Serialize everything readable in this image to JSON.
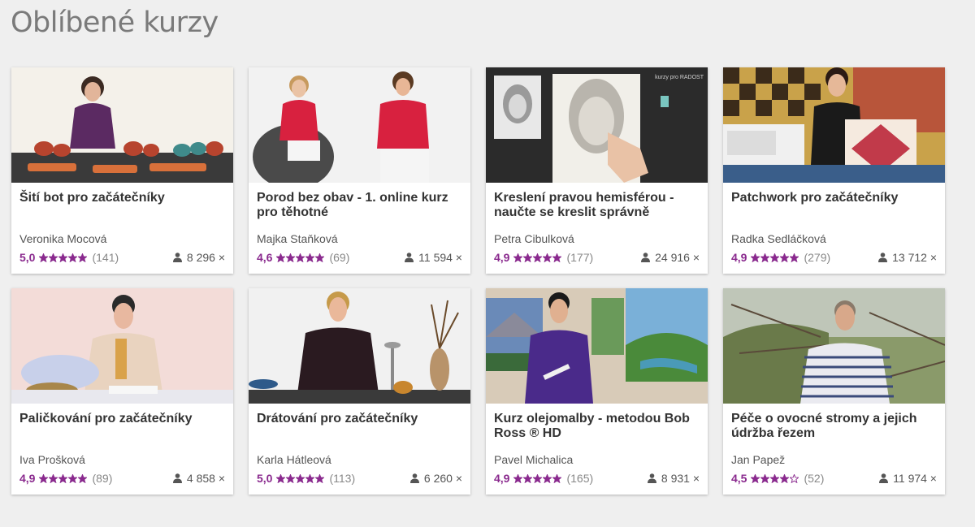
{
  "page": {
    "title": "Oblíbené kurzy"
  },
  "colors": {
    "accent": "#8a2a8e",
    "background": "#efefef",
    "card": "#ffffff"
  },
  "courses": [
    {
      "title": "Šití bot pro začátečníky",
      "author": "Veronika Mocová",
      "rating": "5,0",
      "stars": 5,
      "reviews": "(141)",
      "students": "8 296 ×",
      "thumb_icon": "shoes-workshop-image"
    },
    {
      "title": "Porod bez obav - 1. online kurz pro těhotné",
      "author": "Majka Staňková",
      "rating": "4,6",
      "stars": 5,
      "reviews": "(69)",
      "students": "11 594 ×",
      "thumb_icon": "pregnancy-image"
    },
    {
      "title": "Kreslení pravou hemisférou - naučte se kreslit správně",
      "author": "Petra Cibulková",
      "rating": "4,9",
      "stars": 5,
      "reviews": "(177)",
      "students": "24 916 ×",
      "thumb_icon": "drawing-portrait-image"
    },
    {
      "title": "Patchwork pro začátečníky",
      "author": "Radka Sedláčková",
      "rating": "4,9",
      "stars": 5,
      "reviews": "(279)",
      "students": "13 712 ×",
      "thumb_icon": "patchwork-image"
    },
    {
      "title": "Paličkování pro začátečníky",
      "author": "Iva Prošková",
      "rating": "4,9",
      "stars": 5,
      "reviews": "(89)",
      "students": "4 858 ×",
      "thumb_icon": "bobbin-lace-image"
    },
    {
      "title": "Drátování pro začátečníky",
      "author": "Karla Hátleová",
      "rating": "5,0",
      "stars": 5,
      "reviews": "(113)",
      "students": "6 260 ×",
      "thumb_icon": "wirework-image"
    },
    {
      "title": "Kurz olejomalby - metodou Bob Ross ® HD",
      "author": "Pavel Michalica",
      "rating": "4,9",
      "stars": 5,
      "reviews": "(165)",
      "students": "8 931 ×",
      "thumb_icon": "oil-painting-image"
    },
    {
      "title": "Péče o ovocné stromy a jejich údržba řezem",
      "author": "Jan Papež",
      "rating": "4,5",
      "stars": 4,
      "reviews": "(52)",
      "students": "11 974 ×",
      "thumb_icon": "fruit-tree-image"
    }
  ],
  "thumb_watermark": "kurzy pro RADOST"
}
